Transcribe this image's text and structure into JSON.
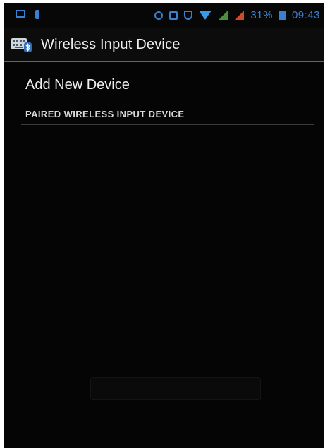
{
  "status_bar": {
    "battery_text": "31%",
    "time": "09:43"
  },
  "action_bar": {
    "title": "Wireless Input Device",
    "icon": "keyboard-bluetooth-icon"
  },
  "content": {
    "add_device_label": "Add New Device",
    "section_header": "PAIRED WIRELESS INPUT DEVICE",
    "bottom_button_label": ""
  },
  "colors": {
    "background": "#050505",
    "status_icons": "#3b7fcf",
    "title_text": "#eeeeee"
  }
}
